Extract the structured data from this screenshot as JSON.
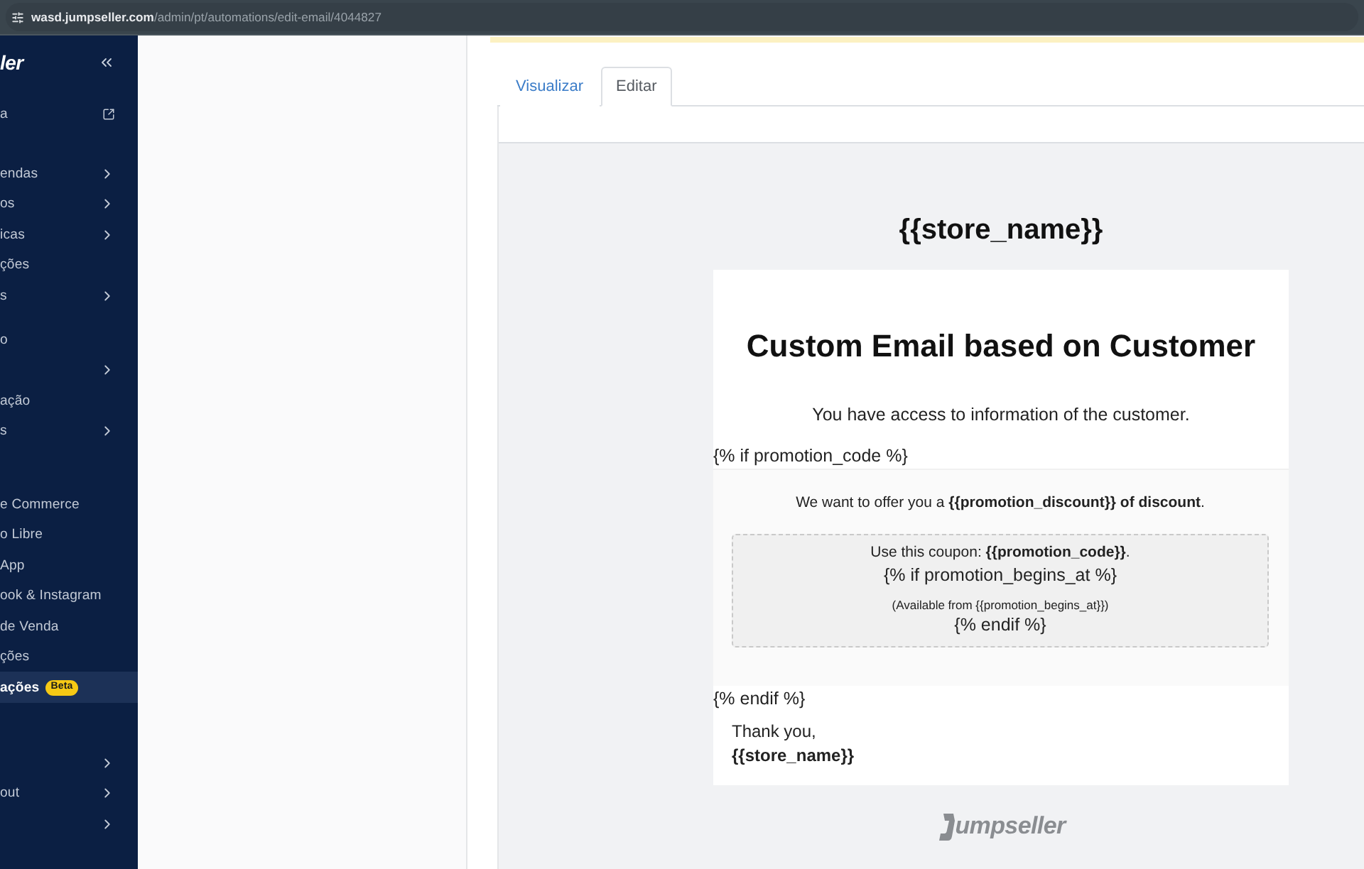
{
  "browser": {
    "url_host": "wasd.jumpseller.com",
    "url_path": "/admin/pt/automations/edit-email/4044827"
  },
  "sidebar": {
    "logo": "ler",
    "groups": [
      {
        "items": [
          {
            "label": "a",
            "kind": "external",
            "selected": false
          }
        ]
      },
      {
        "items": [
          {
            "label": "endas",
            "kind": "submenu",
            "selected": false
          },
          {
            "label": "os",
            "kind": "submenu",
            "selected": false
          },
          {
            "label": "icas",
            "kind": "submenu",
            "selected": false
          },
          {
            "label": "ções",
            "kind": "link",
            "selected": false
          },
          {
            "label": "s",
            "kind": "submenu",
            "selected": false
          }
        ]
      },
      {
        "items": [
          {
            "label": "o",
            "kind": "link",
            "selected": false
          },
          {
            "kind": "submenu",
            "selected": false
          },
          {
            "label": "ação",
            "kind": "link",
            "selected": false
          },
          {
            "label": "s",
            "kind": "submenu",
            "selected": false
          }
        ]
      },
      {
        "items": [
          {
            "label": "e Commerce",
            "kind": "link",
            "selected": false
          },
          {
            "label": "o Libre",
            "kind": "link",
            "selected": false
          },
          {
            "label": "App",
            "kind": "link",
            "selected": false
          },
          {
            "label": "ook & Instagram",
            "kind": "link",
            "selected": false
          },
          {
            "label": "de Venda",
            "kind": "link",
            "selected": false
          },
          {
            "label": "ções",
            "kind": "link",
            "selected": false
          },
          {
            "label": "ações",
            "kind": "link",
            "badge": "Beta",
            "selected": true
          }
        ]
      },
      {
        "items": [
          {
            "kind": "submenu",
            "selected": false
          },
          {
            "label": "out",
            "kind": "submenu",
            "selected": false
          },
          {
            "kind": "submenu",
            "selected": false
          }
        ]
      }
    ]
  },
  "tabs": [
    {
      "label": "Visualizar",
      "selected": false
    },
    {
      "label": "Editar",
      "selected": true
    }
  ],
  "preview": {
    "store_name_header": "{{store_name}}",
    "title": "Custom Email based on Customer",
    "intro": "You have access to information of the customer.",
    "if_open": "{% if promotion_code %}",
    "offer": "We want to offer you a **{{promotion_discount}} of discount**.",
    "coupon": {
      "line": "Use this coupon: **{{promotion_code}}**.",
      "if_open": "{% if promotion_begins_at %}",
      "available": "(Available from {{promotion_begins_at}})",
      "if_close": "{% endif %}"
    },
    "if_close": "{% endif %}",
    "closing": "Thank you,",
    "signature": "{{store_name}}"
  },
  "footer_logo": "umpseller"
}
